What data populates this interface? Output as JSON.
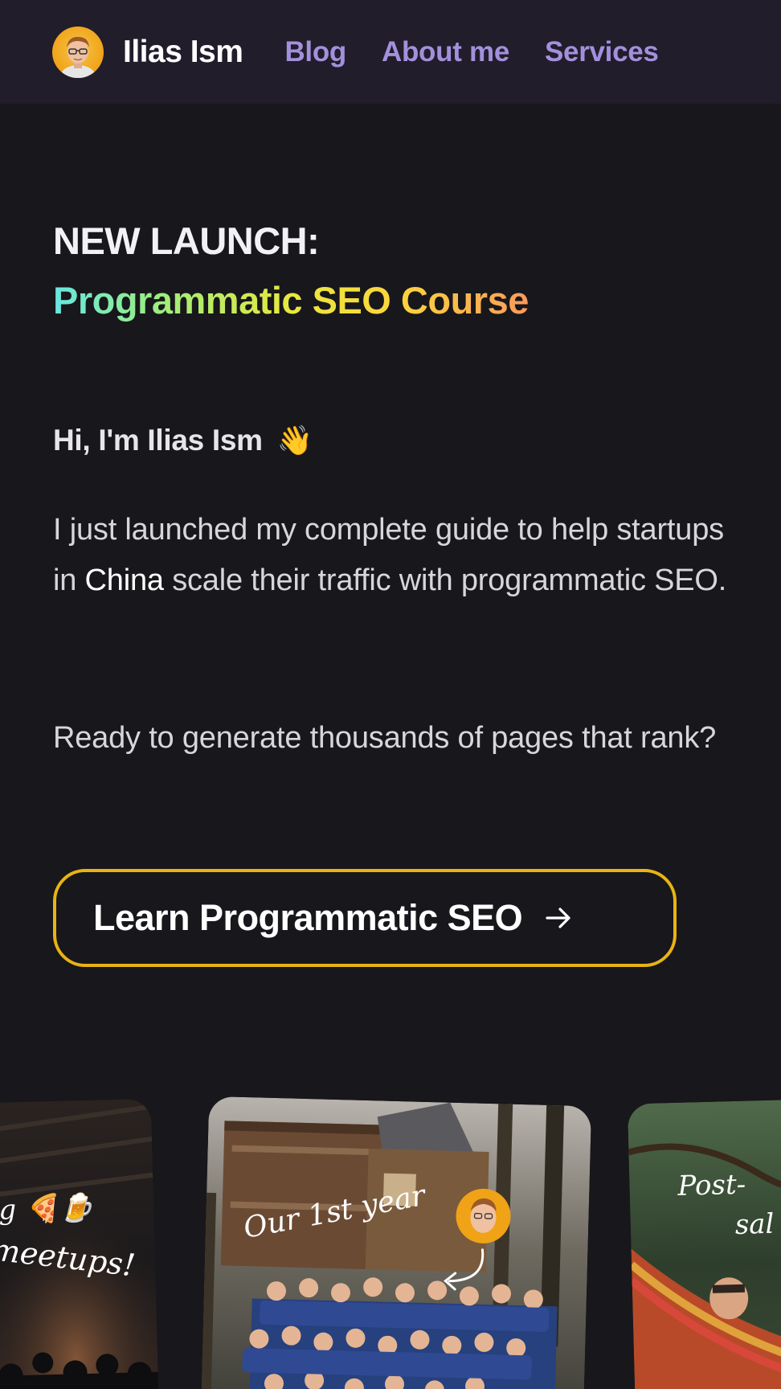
{
  "header": {
    "brand_name": "Ilias Ism",
    "nav": [
      {
        "label": "Blog"
      },
      {
        "label": "About me"
      },
      {
        "label": "Services"
      }
    ]
  },
  "hero": {
    "launch_label": "NEW LAUNCH:",
    "course_label": "Programmatic SEO Course",
    "greeting": "Hi, I'm Ilias Ism",
    "wave_emoji": "👋",
    "intro_before": "I just launched my complete guide to help startups in ",
    "intro_highlight": "China",
    "intro_after": " scale their traffic with programmatic SEO.",
    "question": "Ready to generate thousands of pages that rank?",
    "cta_label": "Learn Programmatic SEO",
    "cta_icon": "arrow-right-icon"
  },
  "gallery": {
    "left_caption_line1": "g 🍕🍺",
    "left_caption_line2": "meetups!",
    "mid_caption": "Our 1st year",
    "right_caption_line1": "Post-",
    "right_caption_line2": "sal"
  },
  "colors": {
    "header_bg": "#211d2b",
    "page_bg": "#18171b",
    "nav_link": "#a390dc",
    "cta_border": "#e9b314"
  }
}
